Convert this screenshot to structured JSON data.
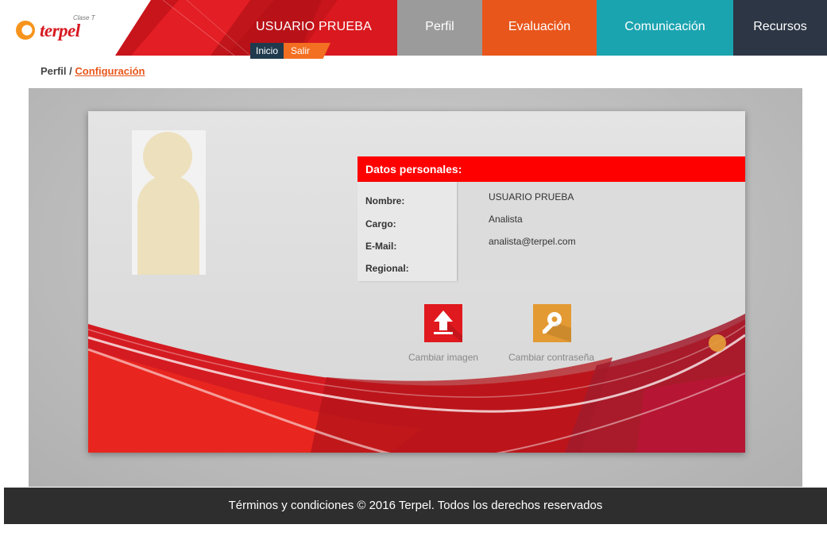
{
  "header": {
    "logo": {
      "word": "terpel",
      "superscript": "Clase T"
    },
    "user_name": "USUARIO PRUEBA",
    "sub_links": {
      "home": "Inicio",
      "logout": "Salir"
    },
    "nav": [
      {
        "label": "Perfil",
        "color": "#9b9b9b"
      },
      {
        "label": "Evaluación",
        "color": "#e8561b"
      },
      {
        "label": "Comunicación",
        "color": "#1aa4b0"
      },
      {
        "label": "Recursos",
        "color": "#2d3644"
      }
    ]
  },
  "breadcrumb": {
    "root": "Perfil",
    "separator": " / ",
    "current": "Configuración"
  },
  "profile": {
    "panel_title": "Datos personales:",
    "fields": [
      {
        "label": "Nombre:",
        "value": "USUARIO PRUEBA"
      },
      {
        "label": "Cargo:",
        "value": "Analista"
      },
      {
        "label": "E-Mail:",
        "value": "analista@terpel.com"
      },
      {
        "label": "Regional:",
        "value": ""
      }
    ],
    "actions": [
      {
        "label": "Cambiar imagen",
        "icon": "upload-icon"
      },
      {
        "label": "Cambiar contraseña",
        "icon": "key-icon"
      }
    ]
  },
  "footer": {
    "text": "Términos y condiciones © 2016 Terpel. Todos los derechos reservados"
  },
  "colors": {
    "brand_red": "#ff0000",
    "accent_orange": "#e8561b",
    "footer_bg": "#2e2e2e"
  }
}
